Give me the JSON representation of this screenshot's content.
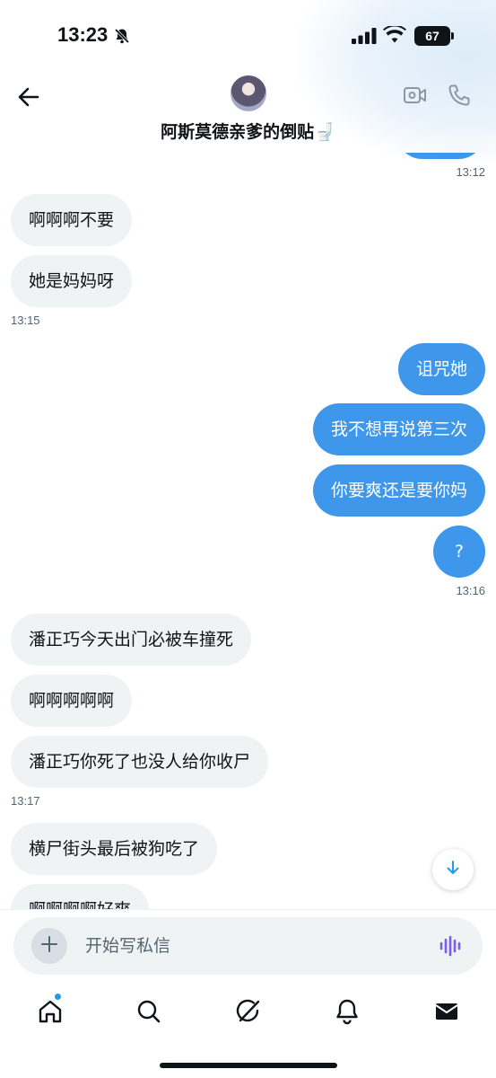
{
  "status_bar": {
    "time": "13:23",
    "battery": "67"
  },
  "header": {
    "title": "阿斯莫德亲爹的倒贴🚽"
  },
  "messages": [
    {
      "side": "in",
      "text": "啊啊啊不要"
    },
    {
      "side": "in",
      "text": "她是妈妈呀"
    },
    {
      "side": "out",
      "text": "诅咒她"
    },
    {
      "side": "out",
      "text": "我不想再说第三次"
    },
    {
      "side": "out",
      "text": "你要爽还是要你妈"
    },
    {
      "side": "out",
      "text": "?"
    },
    {
      "side": "in",
      "text": "潘正巧今天出门必被车撞死"
    },
    {
      "side": "in",
      "text": "啊啊啊啊啊"
    },
    {
      "side": "in",
      "text": "潘正巧你死了也没人给你收尸"
    },
    {
      "side": "in",
      "text": "横尸街头最后被狗吃了"
    },
    {
      "side": "in",
      "text": "啊啊啊啊好爽"
    }
  ],
  "timestamps": [
    "13:12",
    "13:15",
    "13:16",
    "13:17"
  ],
  "composer": {
    "placeholder": "开始写私信"
  },
  "colors": {
    "outgoing_bubble": "#3e97ea",
    "incoming_bubble": "#eff3f4",
    "accent": "#1d9bf0",
    "voice_icon": "#7c5cf0"
  },
  "icons": {
    "header": [
      "back-arrow-icon",
      "video-call-icon",
      "phone-call-icon"
    ],
    "composer": [
      "plus-icon",
      "voice-message-icon"
    ],
    "tabbar": [
      "home-icon",
      "search-icon",
      "grok-icon",
      "notifications-icon",
      "messages-icon"
    ],
    "other": [
      "scroll-down-icon",
      "bell-mute-icon",
      "signal-icon",
      "wifi-icon"
    ]
  }
}
